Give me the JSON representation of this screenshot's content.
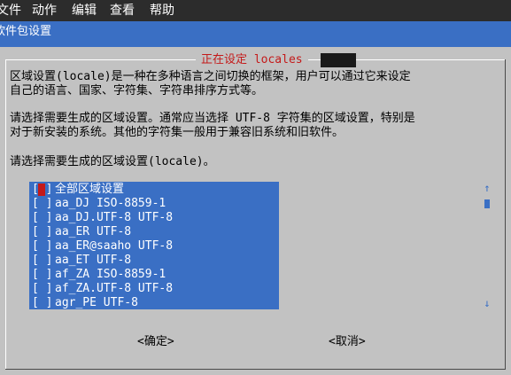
{
  "menubar": {
    "items": [
      "文件",
      "动作",
      "编辑",
      "查看",
      "帮助"
    ]
  },
  "backtitle": "软件包设置",
  "dialog": {
    "title": "正在设定 locales",
    "paragraph1_line1": "区域设置(locale)是一种在多种语言之间切换的框架，用户可以通过它来设定",
    "paragraph1_line2": "自己的语言、国家、字符集、字符串排序方式等。",
    "paragraph2_line1": "请选择需要生成的区域设置。通常应当选择 UTF-8 字符集的区域设置，特别是",
    "paragraph2_line2": "对于新安装的系统。其他的字符集一般用于兼容旧系统和旧软件。",
    "prompt": "请选择需要生成的区域设置(locale)。",
    "list": [
      {
        "checkbox": "[ ]",
        "label": "全部区域设置"
      },
      {
        "checkbox": "[ ]",
        "label": "aa_DJ ISO-8859-1"
      },
      {
        "checkbox": "[ ]",
        "label": "aa_DJ.UTF-8 UTF-8"
      },
      {
        "checkbox": "[ ]",
        "label": "aa_ER UTF-8"
      },
      {
        "checkbox": "[ ]",
        "label": "aa_ER@saaho UTF-8"
      },
      {
        "checkbox": "[ ]",
        "label": "aa_ET UTF-8"
      },
      {
        "checkbox": "[ ]",
        "label": "af_ZA ISO-8859-1"
      },
      {
        "checkbox": "[ ]",
        "label": "af_ZA.UTF-8 UTF-8"
      },
      {
        "checkbox": "[ ]",
        "label": "agr_PE UTF-8"
      }
    ],
    "scroll_up": "↑",
    "scroll_down": "↓",
    "ok_button": "<确定>",
    "cancel_button": "<取消>"
  },
  "colors": {
    "accent_blue": "#3a6fc4",
    "title_red": "#c41a1a",
    "background_gray": "#c2c2c2"
  }
}
